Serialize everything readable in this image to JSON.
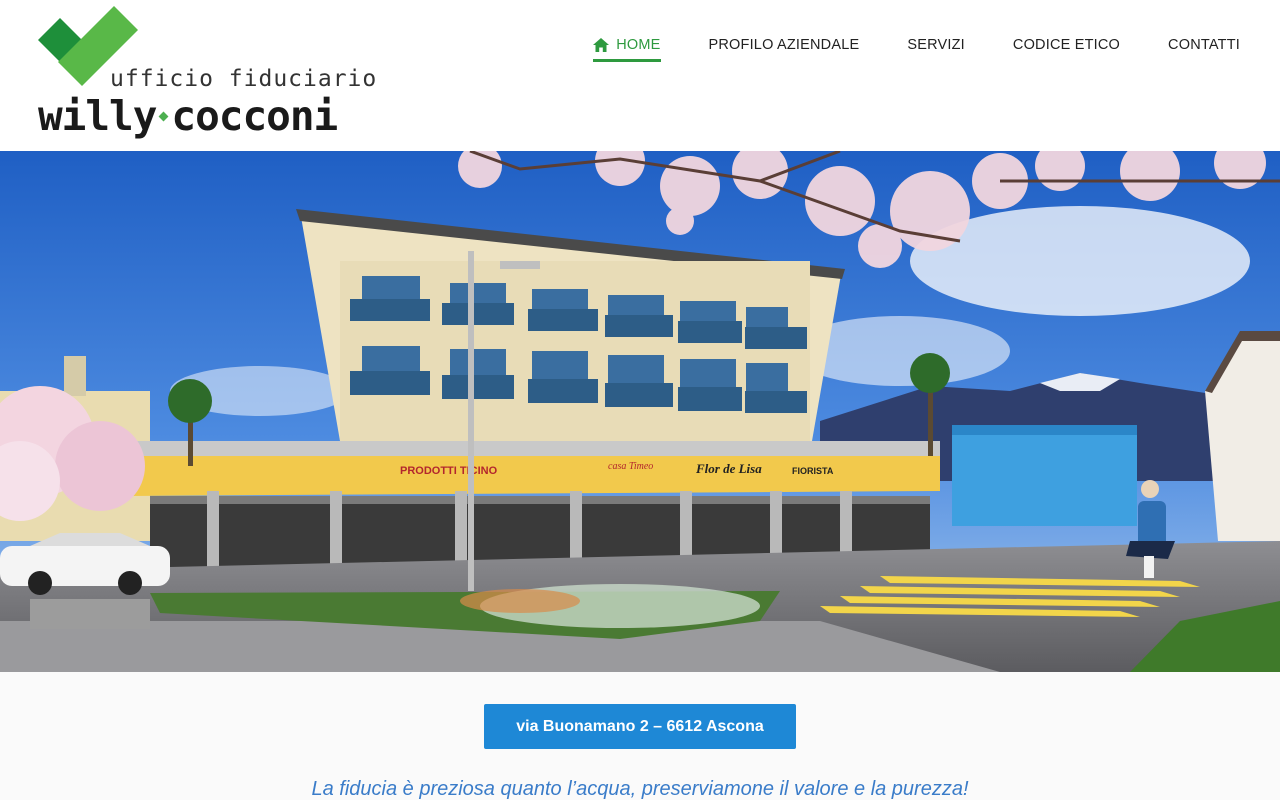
{
  "logo": {
    "tagline": "ufficio fiduciario",
    "name_first": "willy",
    "name_last": "cocconi",
    "icon": "checkmark-logo"
  },
  "nav": {
    "items": [
      {
        "label": "HOME",
        "icon": "home-icon",
        "active": true
      },
      {
        "label": "PROFILO AZIENDALE",
        "active": false
      },
      {
        "label": "SERVIZI",
        "active": false
      },
      {
        "label": "CODICE ETICO",
        "active": false
      },
      {
        "label": "CONTATTI",
        "active": false
      }
    ]
  },
  "hero": {
    "shop_signs": [
      "PRODOTTI TICINO",
      "casa Timeo",
      "Flor de Lisa",
      "FIORISTA"
    ]
  },
  "address_button": "via Buonamano 2 – 6612 Ascona",
  "motto": "La fiducia è preziosa quanto l’acqua, preserviamone il valore e la purezza!",
  "colors": {
    "accent_green": "#2e9a3f",
    "button_blue": "#1e88d6",
    "motto_blue": "#3a7cc9"
  }
}
